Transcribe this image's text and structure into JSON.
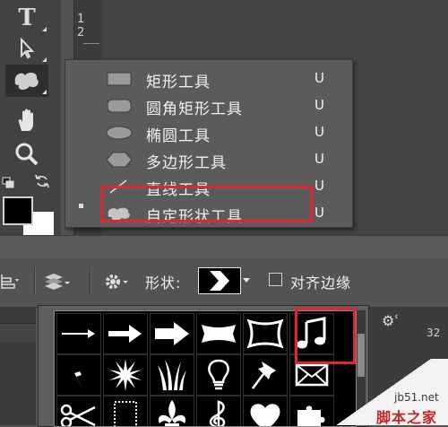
{
  "rulers": {
    "vertical_label": "1\n2",
    "horizontal_right_label": "32"
  },
  "toolbar": {
    "tools": [
      {
        "name": "type",
        "icon": "type-icon"
      },
      {
        "name": "path-selection",
        "icon": "arrow-cursor-icon"
      },
      {
        "name": "custom-shape",
        "icon": "custom-shape-icon"
      },
      {
        "name": "hand",
        "icon": "hand-icon"
      },
      {
        "name": "zoom",
        "icon": "magnifier-icon"
      }
    ],
    "foreground_color": "#000000",
    "background_color": "#ffffff"
  },
  "shape_flyout": {
    "items": [
      {
        "label": "矩形工具",
        "shortcut": "U",
        "icon": "rectangle-icon"
      },
      {
        "label": "圆角矩形工具",
        "shortcut": "U",
        "icon": "rounded-rectangle-icon"
      },
      {
        "label": "椭圆工具",
        "shortcut": "U",
        "icon": "ellipse-icon"
      },
      {
        "label": "多边形工具",
        "shortcut": "U",
        "icon": "polygon-icon"
      },
      {
        "label": "直线工具",
        "shortcut": "U",
        "icon": "line-icon"
      },
      {
        "label": "自定形状工具",
        "shortcut": "U",
        "icon": "custom-shape-icon"
      }
    ],
    "active_index": 5
  },
  "options_bar": {
    "shape_label": "形状:",
    "align_edges_label": "对齐边缘",
    "align_edges_checked": false
  },
  "shape_panel": {
    "shapes": [
      "thin-arrow-icon",
      "arrow-icon",
      "bold-arrow-icon",
      "banner-icon",
      "frame-icon",
      "music-note-icon",
      "lightning-icon",
      "starburst-icon",
      "grass-icon",
      "lightbulb-icon",
      "pushpin-icon",
      "envelope-icon",
      "scissors-icon",
      "dotted-frame-icon",
      "fleur-de-lis-icon",
      "treble-clef-icon",
      "heart-icon",
      "puzzle-icon"
    ],
    "selected_index": 5
  },
  "accent_color": "#e0262f",
  "watermark": {
    "site": "jb51.net",
    "name": "脚本之家"
  }
}
